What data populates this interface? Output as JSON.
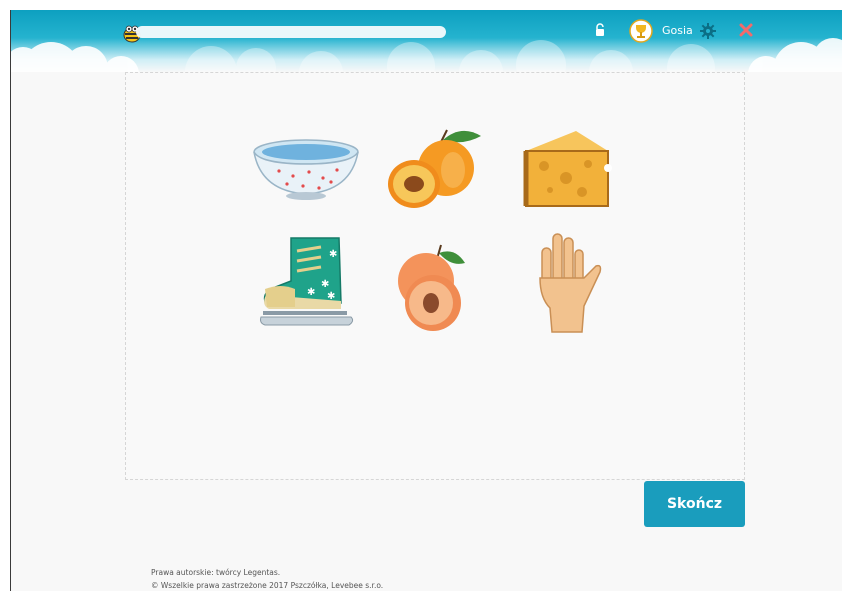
{
  "header": {
    "user_name": "Gosia",
    "icons": [
      "bee-logo-icon",
      "lock-icon",
      "trophy-avatar-icon",
      "gear-icon",
      "close-icon"
    ],
    "accent_color": "#15aacb",
    "close_color": "#f26b6b"
  },
  "board": {
    "items": [
      {
        "name": "bowl"
      },
      {
        "name": "apricot"
      },
      {
        "name": "cheese"
      },
      {
        "name": "ice-skate"
      },
      {
        "name": "peach"
      },
      {
        "name": "hand"
      }
    ]
  },
  "actions": {
    "finish_label": "Skończ",
    "finish_color": "#1a9dbd"
  },
  "footer": {
    "line1": "Prawa autorskie: twórcy Legentas.",
    "line2": "© Wszelkie prawa zastrzeżone 2017 Pszczółka, Levebee s.r.o."
  }
}
